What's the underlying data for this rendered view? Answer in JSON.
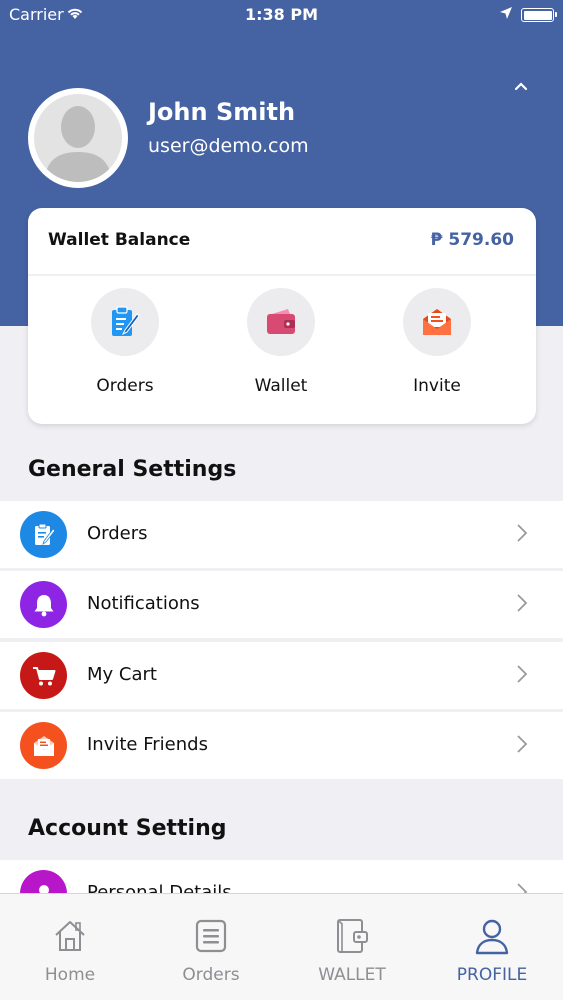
{
  "status_bar": {
    "carrier": "Carrier",
    "time": "1:38 PM"
  },
  "profile": {
    "name": "John Smith",
    "email": "user@demo.com"
  },
  "wallet_card": {
    "title": "Wallet Balance",
    "balance": "₱ 579.60",
    "quick_actions": [
      {
        "label": "Orders",
        "icon": "clipboard-icon",
        "color": "#2196f3"
      },
      {
        "label": "Wallet",
        "icon": "wallet-icon",
        "color": "#d94a73"
      },
      {
        "label": "Invite",
        "icon": "envelope-icon",
        "color": "#f4511e"
      }
    ]
  },
  "general_settings": {
    "title": "General Settings",
    "items": [
      {
        "label": "Orders",
        "icon": "clipboard-icon",
        "color": "#1e88e5"
      },
      {
        "label": "Notifications",
        "icon": "bell-icon",
        "color": "#8e24e4"
      },
      {
        "label": "My Cart",
        "icon": "cart-icon",
        "color": "#c71818"
      },
      {
        "label": "Invite Friends",
        "icon": "envelope-icon",
        "color": "#f4511e"
      }
    ]
  },
  "account_setting": {
    "title": "Account Setting",
    "items": [
      {
        "label": "Personal Details",
        "icon": "person-icon",
        "color": "#b717c9"
      }
    ]
  },
  "tab_bar": {
    "tabs": [
      {
        "label": "Home",
        "icon": "home-icon",
        "active": false
      },
      {
        "label": "Orders",
        "icon": "list-icon",
        "active": false
      },
      {
        "label": "WALLET",
        "icon": "wallet-icon",
        "active": false
      },
      {
        "label": "PROFILE",
        "icon": "person-icon",
        "active": true
      }
    ]
  },
  "colors": {
    "header": "#4562a3",
    "accent": "#4562a3",
    "inactive_tab": "#8e8e93"
  }
}
